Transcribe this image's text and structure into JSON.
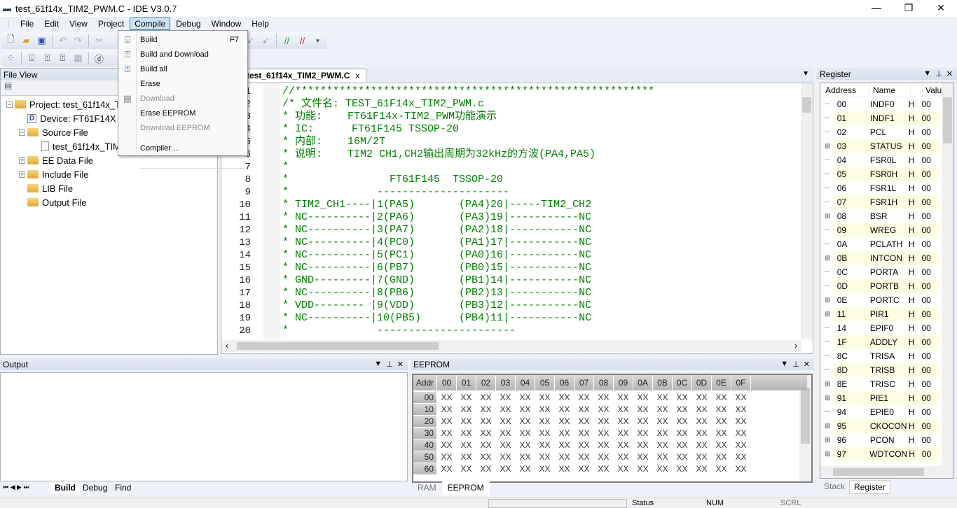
{
  "window": {
    "title": "test_61f14x_TIM2_PWM.C - IDE V3.0.7",
    "min": "—",
    "max": "❐",
    "close": "✕"
  },
  "menu": [
    "File",
    "Edit",
    "View",
    "Project",
    "Compile",
    "Debug",
    "Window",
    "Help"
  ],
  "compile_menu": {
    "items": [
      {
        "label": "Build",
        "shortcut": "F7",
        "icon": "build-icon",
        "enabled": true
      },
      {
        "label": "Build and Download",
        "icon": "build-download-icon",
        "enabled": true
      },
      {
        "label": "Build all",
        "icon": "build-all-icon",
        "enabled": true
      },
      {
        "label": "Erase",
        "enabled": true
      },
      {
        "label": "Download",
        "icon": "download-icon",
        "enabled": false
      },
      {
        "label": "Erase EEPROM",
        "enabled": true
      },
      {
        "label": "Download EEPROM",
        "enabled": false
      },
      {
        "label": "Compiler ...",
        "enabled": true
      }
    ]
  },
  "file_view": {
    "title": "File View",
    "tree": [
      {
        "label": "Project:  test_61f14x_TIM2_PWM",
        "type": "project"
      },
      {
        "label": "Device:  FT61F14X",
        "type": "device"
      },
      {
        "label": "Source File",
        "type": "folder"
      },
      {
        "label": "test_61f14x_TIM2_PWM.C",
        "type": "file"
      },
      {
        "label": "EE Data File",
        "type": "folder"
      },
      {
        "label": "Include File",
        "type": "folder"
      },
      {
        "label": "LIB File",
        "type": "folder"
      },
      {
        "label": "Output File",
        "type": "folder"
      }
    ]
  },
  "editor": {
    "tab": "test_61f14x_TIM2_PWM.C",
    "tab_close": "x",
    "lines": [
      {
        "n": "1",
        "t": "//*********************************************************"
      },
      {
        "n": "2",
        "t": "/* 文件名: TEST_61F14x_TIM2_PWM.c"
      },
      {
        "n": "3",
        "t": "* 功能:    FT61F14x-TIM2_PWM功能演示"
      },
      {
        "n": "4",
        "t": "* IC:      FT61F145 TSSOP-20"
      },
      {
        "n": "5",
        "t": "* 内部:    16M/2T"
      },
      {
        "n": "6",
        "t": "* 说明:    TIM2 CH1,CH2输出周期为32kHz的方波(PA4,PA5)"
      },
      {
        "n": "7",
        "t": "*"
      },
      {
        "n": "8",
        "t": "*                FT61F145  TSSOP-20"
      },
      {
        "n": "9",
        "t": "*              ---------------------"
      },
      {
        "n": "10",
        "t": "* TIM2_CH1----|1(PA5)       (PA4)20|-----TIM2_CH2"
      },
      {
        "n": "11",
        "t": "* NC----------|2(PA6)       (PA3)19|-----------NC"
      },
      {
        "n": "12",
        "t": "* NC----------|3(PA7)       (PA2)18|-----------NC"
      },
      {
        "n": "13",
        "t": "* NC----------|4(PC0)       (PA1)17|-----------NC"
      },
      {
        "n": "14",
        "t": "* NC----------|5(PC1)       (PA0)16|-----------NC"
      },
      {
        "n": "15",
        "t": "* NC----------|6(PB7)       (PB0)15|-----------NC"
      },
      {
        "n": "16",
        "t": "* GND---------|7(GND)       (PB1)14|-----------NC"
      },
      {
        "n": "17",
        "t": "* NC----------|8(PB6)       (PB2)13|-----------NC"
      },
      {
        "n": "18",
        "t": "* VDD-------- |9(VDD)       (PB3)12|-----------NC"
      },
      {
        "n": "19",
        "t": "* NC----------|10(PB5)      (PB4)11|-----------NC"
      },
      {
        "n": "20",
        "t": "*              ----------------------"
      }
    ]
  },
  "register": {
    "title": "Register",
    "columns": [
      "Address",
      "Name",
      "",
      "Valu"
    ],
    "rows": [
      [
        "00",
        "INDF0",
        "H",
        "00",
        false
      ],
      [
        "01",
        "INDF1",
        "H",
        "00",
        false
      ],
      [
        "02",
        "PCL",
        "H",
        "00",
        false
      ],
      [
        "03",
        "STATUS",
        "H",
        "00",
        true
      ],
      [
        "04",
        "FSR0L",
        "H",
        "00",
        false
      ],
      [
        "05",
        "FSR0H",
        "H",
        "00",
        false
      ],
      [
        "06",
        "FSR1L",
        "H",
        "00",
        false
      ],
      [
        "07",
        "FSR1H",
        "H",
        "00",
        false
      ],
      [
        "08",
        "BSR",
        "H",
        "00",
        true
      ],
      [
        "09",
        "WREG",
        "H",
        "00",
        false
      ],
      [
        "0A",
        "PCLATH",
        "H",
        "00",
        false
      ],
      [
        "0B",
        "INTCON",
        "H",
        "00",
        true
      ],
      [
        "0C",
        "PORTA",
        "H",
        "00",
        false
      ],
      [
        "0D",
        "PORTB",
        "H",
        "00",
        false
      ],
      [
        "0E",
        "PORTC",
        "H",
        "00",
        true
      ],
      [
        "11",
        "PIR1",
        "H",
        "00",
        true
      ],
      [
        "14",
        "EPIF0",
        "H",
        "00",
        false
      ],
      [
        "1F",
        "ADDLY",
        "H",
        "00",
        false
      ],
      [
        "8C",
        "TRISA",
        "H",
        "00",
        false
      ],
      [
        "8D",
        "TRISB",
        "H",
        "00",
        false
      ],
      [
        "8E",
        "TRISC",
        "H",
        "00",
        true
      ],
      [
        "91",
        "PIE1",
        "H",
        "00",
        true
      ],
      [
        "94",
        "EPIE0",
        "H",
        "00",
        false
      ],
      [
        "95",
        "CKOCON",
        "H",
        "00",
        true
      ],
      [
        "96",
        "PCON",
        "H",
        "00",
        true
      ],
      [
        "97",
        "WDTCON",
        "H",
        "00",
        true
      ]
    ],
    "tabs": [
      "Stack",
      "Register"
    ]
  },
  "output": {
    "title": "Output",
    "tabs": [
      "Build",
      "Debug",
      "Find"
    ]
  },
  "eeprom": {
    "title": "EEPROM",
    "corner": "Addr",
    "cols": [
      "00",
      "01",
      "02",
      "03",
      "04",
      "05",
      "06",
      "07",
      "08",
      "09",
      "0A",
      "0B",
      "0C",
      "0D",
      "0E",
      "0F"
    ],
    "rows": [
      "00",
      "10",
      "20",
      "30",
      "40",
      "50",
      "60"
    ],
    "value": "XX",
    "tabs": [
      "RAM",
      "EEPROM"
    ]
  },
  "status": {
    "status": "Status",
    "num": "NUM",
    "scrl": "SCRL"
  }
}
